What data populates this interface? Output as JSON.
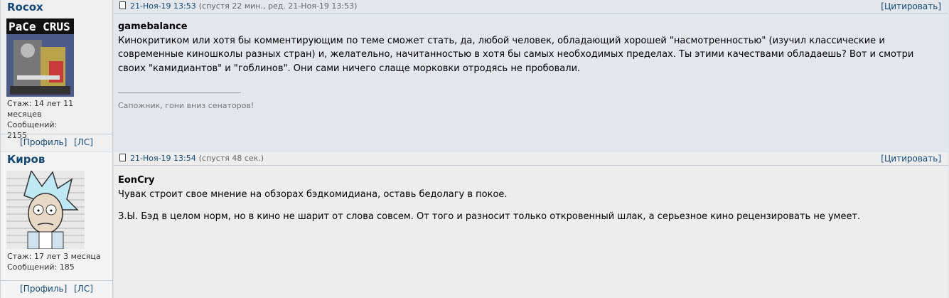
{
  "posts": [
    {
      "nick": "Rocox",
      "avatar_text": "PaCe CRUS",
      "stazh": "Стаж: 14 лет 11 месяцев",
      "messages": "Сообщений: 2155",
      "profile_link": "[Профиль]",
      "pm_link": "[ЛС]",
      "date": "21-Ноя-19 13:53",
      "note": "(спустя 22 мин., ред. 21-Ноя-19 13:53)",
      "quote_label": "[Цитировать]",
      "author": "gamebalance",
      "text": "Кинокритиком или хотя бы комментирующим по теме сможет стать, да, любой человек, обладающий хорошей \"насмотренностью\" (изучил классические и современные киношколы разных стран) и, желательно, начитанностью в хотя бы самых необходимых пределах. Ты этими качествами обладаешь? Вот и смотри своих \"камидиантов\" и \"гоблинов\". Они сами ничего слаще морковки отродясь не пробовали.",
      "signature": "Сапожник, гони вниз сенаторов!"
    },
    {
      "nick": "Киров",
      "stazh": "Стаж: 17 лет 3 месяца",
      "messages": "Сообщений: 185",
      "profile_link": "[Профиль]",
      "pm_link": "[ЛС]",
      "date": "21-Ноя-19 13:54",
      "note": "(спустя 48 сек.)",
      "quote_label": "[Цитировать]",
      "author": "EonCry",
      "line1": "Чувак строит свое мнение на обзорах бэдкомидиана, оставь бедолагу в покое.",
      "line2": "З.Ы. Бэд в целом норм, но в кино не шарит от слова совсем. От того и разносит только откровенный шлак, а серьезное кино рецензировать не умеет."
    }
  ],
  "colors": {
    "link": "#12497a",
    "profile_bg": "#efefef",
    "body_bg": "#e3e6ea"
  }
}
